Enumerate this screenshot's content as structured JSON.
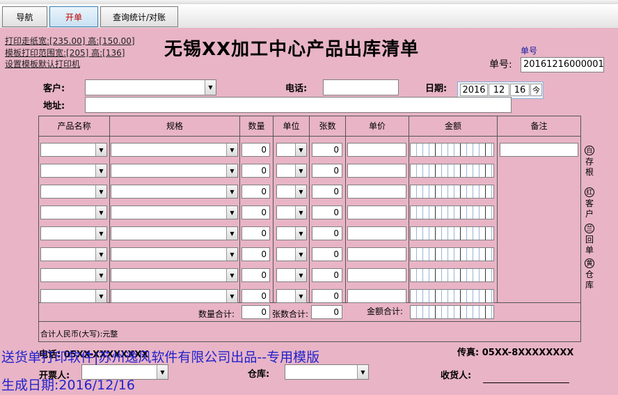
{
  "tabs": [
    {
      "label": "导航"
    },
    {
      "label": "开单"
    },
    {
      "label": "查询统计/对账"
    }
  ],
  "links": {
    "paper": "打印走纸宽:[235.00] 高:[150.00]",
    "range": "模板打印范围宽:[205] 高:[136]",
    "printer": "设置模板默认打印机"
  },
  "form": {
    "title": "无锡XX加工中心产品出库清单",
    "order_no_label": "单号",
    "order_no_label2": "单号:",
    "order_no": "20161216000001",
    "customer_label": "客户:",
    "customer_value": "",
    "phone_label": "电话:",
    "phone_value": "",
    "date_label": "日期:",
    "date": {
      "year": "2016",
      "month": "12",
      "day": "16",
      "today": "今"
    },
    "address_label": "地址:",
    "address_value": ""
  },
  "table": {
    "headers": [
      "产品名称",
      "规格",
      "数量",
      "单位",
      "张数",
      "单价",
      "金额",
      "备注"
    ],
    "rows": [
      {
        "qty": "0",
        "sheets": "0"
      },
      {
        "qty": "0",
        "sheets": "0"
      },
      {
        "qty": "0",
        "sheets": "0"
      },
      {
        "qty": "0",
        "sheets": "0"
      },
      {
        "qty": "0",
        "sheets": "0"
      },
      {
        "qty": "0",
        "sheets": "0"
      },
      {
        "qty": "0",
        "sheets": "0"
      },
      {
        "qty": "0",
        "sheets": "0"
      }
    ],
    "qty_total_label": "数量合计:",
    "qty_total": "0",
    "sheets_total_label": "张数合计:",
    "sheets_total": "0",
    "amount_total_label": "金额合计:",
    "uppercase_label": "合计人民币(大写):元整"
  },
  "side": [
    {
      "icon": "白",
      "text": [
        "存",
        "根"
      ]
    },
    {
      "icon": "红",
      "text": [
        "客",
        "户"
      ]
    },
    {
      "icon": "兰",
      "text": [
        "回",
        "单"
      ]
    },
    {
      "icon": "黄",
      "text": [
        "仓",
        "库"
      ]
    }
  ],
  "footer": {
    "phone": "电话: 05XX-XXXXXXXX",
    "fax": "传真: 05XX-8XXXXXXXX",
    "issuer_label": "开票人:",
    "warehouse_label": "仓库:",
    "receiver_label": "收货人:"
  },
  "overlay": {
    "line1": "送货单打印软件|苏州逸风软件有限公司出品--专用模版",
    "line2": "生成日期:2016/12/16"
  },
  "colors": {
    "background": "#e8b4c6",
    "overlay_text": "#2222cc",
    "active_tab": "#c00000"
  }
}
